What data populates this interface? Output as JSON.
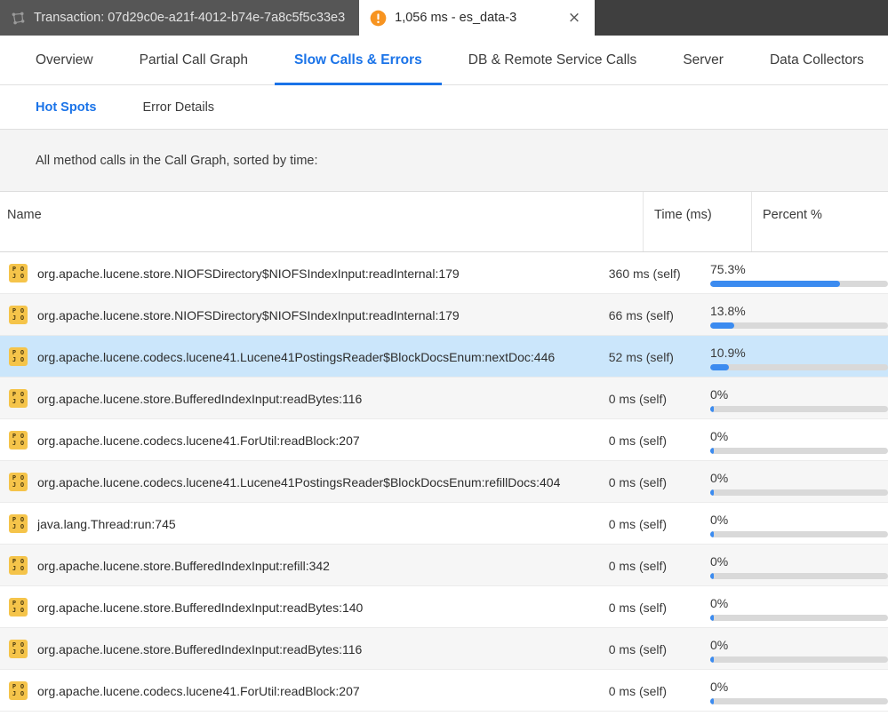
{
  "window_tabs": [
    {
      "icon": "graph-node-icon",
      "label": "Transaction: 07d29c0e-a21f-4012-b74e-7a8c5f5c33e3",
      "active": false,
      "closable": false
    },
    {
      "icon": "warning-icon",
      "label": "1,056 ms - es_data-3",
      "active": true,
      "closable": true,
      "close_label": "×"
    }
  ],
  "primary_nav": [
    {
      "label": "Overview",
      "active": false
    },
    {
      "label": "Partial Call Graph",
      "active": false
    },
    {
      "label": "Slow Calls & Errors",
      "active": true
    },
    {
      "label": "DB & Remote Service Calls",
      "active": false
    },
    {
      "label": "Server",
      "active": false
    },
    {
      "label": "Data Collectors",
      "active": false
    }
  ],
  "secondary_nav": [
    {
      "label": "Hot Spots",
      "active": true
    },
    {
      "label": "Error Details",
      "active": false
    }
  ],
  "banner": {
    "text": "All method calls in the Call Graph, sorted by time:"
  },
  "table": {
    "columns": [
      {
        "key": "name",
        "label": "Name"
      },
      {
        "key": "time",
        "label": "Time (ms)"
      },
      {
        "key": "percent",
        "label": "Percent %"
      }
    ],
    "rows": [
      {
        "icon": "pojo-icon",
        "name": "org.apache.lucene.store.NIOFSDirectory$NIOFSIndexInput:readInternal:179",
        "time": "360 ms (self)",
        "percent": "75.3%",
        "percent_value": 75.3,
        "selected": false
      },
      {
        "icon": "pojo-icon",
        "name": "org.apache.lucene.store.NIOFSDirectory$NIOFSIndexInput:readInternal:179",
        "time": "66 ms (self)",
        "percent": "13.8%",
        "percent_value": 13.8,
        "selected": false
      },
      {
        "icon": "pojo-icon",
        "name": "org.apache.lucene.codecs.lucene41.Lucene41PostingsReader$BlockDocsEnum:nextDoc:446",
        "time": "52 ms (self)",
        "percent": "10.9%",
        "percent_value": 10.9,
        "selected": true
      },
      {
        "icon": "pojo-icon",
        "name": "org.apache.lucene.store.BufferedIndexInput:readBytes:116",
        "time": "0 ms (self)",
        "percent": "0%",
        "percent_value": 0,
        "selected": false
      },
      {
        "icon": "pojo-icon",
        "name": "org.apache.lucene.codecs.lucene41.ForUtil:readBlock:207",
        "time": "0 ms (self)",
        "percent": "0%",
        "percent_value": 0,
        "selected": false
      },
      {
        "icon": "pojo-icon",
        "name": "org.apache.lucene.codecs.lucene41.Lucene41PostingsReader$BlockDocsEnum:refillDocs:404",
        "time": "0 ms (self)",
        "percent": "0%",
        "percent_value": 0,
        "selected": false
      },
      {
        "icon": "pojo-icon",
        "name": "java.lang.Thread:run:745",
        "time": "0 ms (self)",
        "percent": "0%",
        "percent_value": 0,
        "selected": false
      },
      {
        "icon": "pojo-icon",
        "name": "org.apache.lucene.store.BufferedIndexInput:refill:342",
        "time": "0 ms (self)",
        "percent": "0%",
        "percent_value": 0,
        "selected": false
      },
      {
        "icon": "pojo-icon",
        "name": "org.apache.lucene.store.BufferedIndexInput:readBytes:140",
        "time": "0 ms (self)",
        "percent": "0%",
        "percent_value": 0,
        "selected": false
      },
      {
        "icon": "pojo-icon",
        "name": "org.apache.lucene.store.BufferedIndexInput:readBytes:116",
        "time": "0 ms (self)",
        "percent": "0%",
        "percent_value": 0,
        "selected": false
      },
      {
        "icon": "pojo-icon",
        "name": "org.apache.lucene.codecs.lucene41.ForUtil:readBlock:207",
        "time": "0 ms (self)",
        "percent": "0%",
        "percent_value": 0,
        "selected": false
      }
    ]
  },
  "colors": {
    "accent_blue": "#1a73e8",
    "bar_blue": "#3b8bf0",
    "bar_track": "#d9d9d9",
    "warning_orange": "#f79421",
    "pojo_yellow": "#f5c44a",
    "selected_row": "#cbe6fb",
    "tabstrip_bg": "#3f3f3f",
    "inactive_tab_bg": "#565656"
  },
  "pojo_letters": [
    "P",
    "O",
    "J",
    "O"
  ]
}
